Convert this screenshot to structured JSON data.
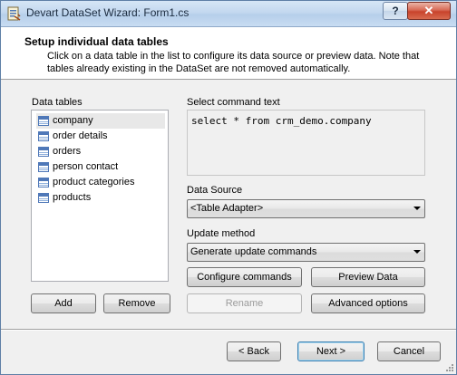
{
  "window": {
    "title": "Devart DataSet Wizard: Form1.cs",
    "help_label": "?",
    "close_label": "✕"
  },
  "header": {
    "title": "Setup individual data tables",
    "description": "Click on a data table in the list to configure its data source or preview data. Note that tables already existing in the DataSet are not removed automatically."
  },
  "tables": {
    "label": "Data tables",
    "items": [
      "company",
      "order details",
      "orders",
      "person contact",
      "product categories",
      "products"
    ],
    "selected_index": 0
  },
  "command": {
    "label": "Select command text",
    "text": "select * from crm_demo.company"
  },
  "data_source": {
    "label": "Data Source",
    "value": "<Table Adapter>"
  },
  "update_method": {
    "label": "Update method",
    "value": "Generate update commands"
  },
  "buttons": {
    "add": "Add",
    "remove": "Remove",
    "configure": "Configure commands",
    "preview": "Preview Data",
    "rename": "Rename",
    "advanced": "Advanced options",
    "back": "< Back",
    "next": "Next >",
    "cancel": "Cancel"
  },
  "colors": {
    "title_bar": "#c3d8ef",
    "close_button": "#c8432c",
    "table_icon": "#4f78b8",
    "selection": "#e8e8e8"
  }
}
